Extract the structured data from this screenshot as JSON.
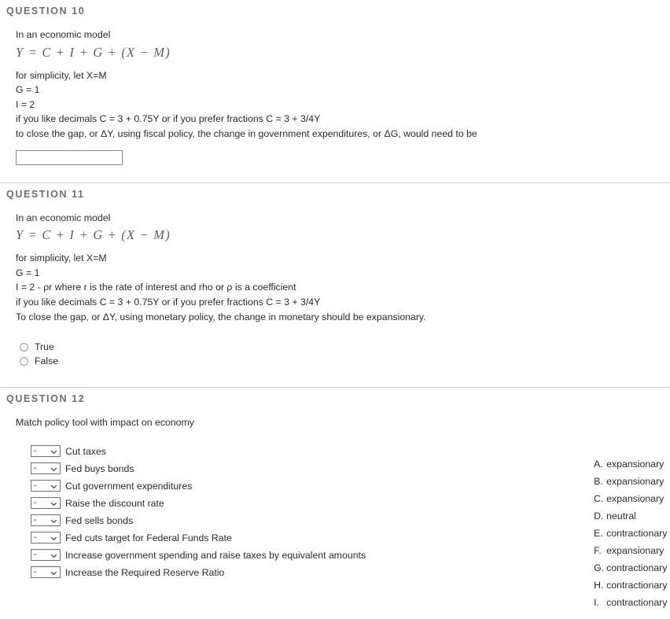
{
  "questions": [
    {
      "header": "QUESTION 10",
      "intro": "In an economic model",
      "formula": "Y = C + I + G + (X − M)",
      "lines": [
        "for simplicity, let X=M",
        "G = 1",
        "I = 2",
        "if you like decimals C = 3 + 0.75Y or if you prefer fractions C = 3 + 3/4Y",
        "to close the gap, or ΔY, using fiscal policy, the change in government expenditures, or ΔG, would need to be"
      ],
      "input": {
        "value": "",
        "placeholder": ""
      }
    },
    {
      "header": "QUESTION 11",
      "intro": "In an economic model",
      "formula": "Y = C + I + G + (X − M)",
      "lines": [
        "for simplicity, let X=M",
        "G = 1",
        "I = 2 - ρr where r is the rate of interest and rho or ρ is a coefficient",
        "if you like decimals C = 3 + 0.75Y or if you prefer fractions C = 3 + 3/4Y",
        "To close the gap, or ΔY, using monetary policy, the change in monetary should be expansionary."
      ],
      "choices": [
        {
          "label": "True",
          "selected": false
        },
        {
          "label": "False",
          "selected": false
        }
      ]
    },
    {
      "header": "QUESTION 12",
      "prompt": "Match policy tool with impact on economy",
      "select_value": "-",
      "items": [
        "Cut taxes",
        "Fed buys bonds",
        "Cut government expenditures",
        "Raise the discount rate",
        "Fed sells bonds",
        "Fed cuts target for Federal Funds Rate",
        "Increase government spending and raise taxes by equivalent amounts",
        "Increase the Required Reserve Ratio"
      ],
      "options": [
        {
          "letter": "A.",
          "text": "expansionary"
        },
        {
          "letter": "B.",
          "text": "expansionary"
        },
        {
          "letter": "C.",
          "text": "expansionary"
        },
        {
          "letter": "D.",
          "text": "neutral"
        },
        {
          "letter": "E.",
          "text": "contractionary"
        },
        {
          "letter": "F.",
          "text": "expansionary"
        },
        {
          "letter": "G.",
          "text": "contractionary"
        },
        {
          "letter": "H.",
          "text": "contractionary"
        },
        {
          "letter": "I.",
          "text": "contractionary"
        }
      ]
    }
  ],
  "colors": {
    "divider": "#cfcfcf",
    "header_text": "#6e6e6e",
    "body_text": "#2b2b2b",
    "formula_text": "#5f5f5f"
  }
}
